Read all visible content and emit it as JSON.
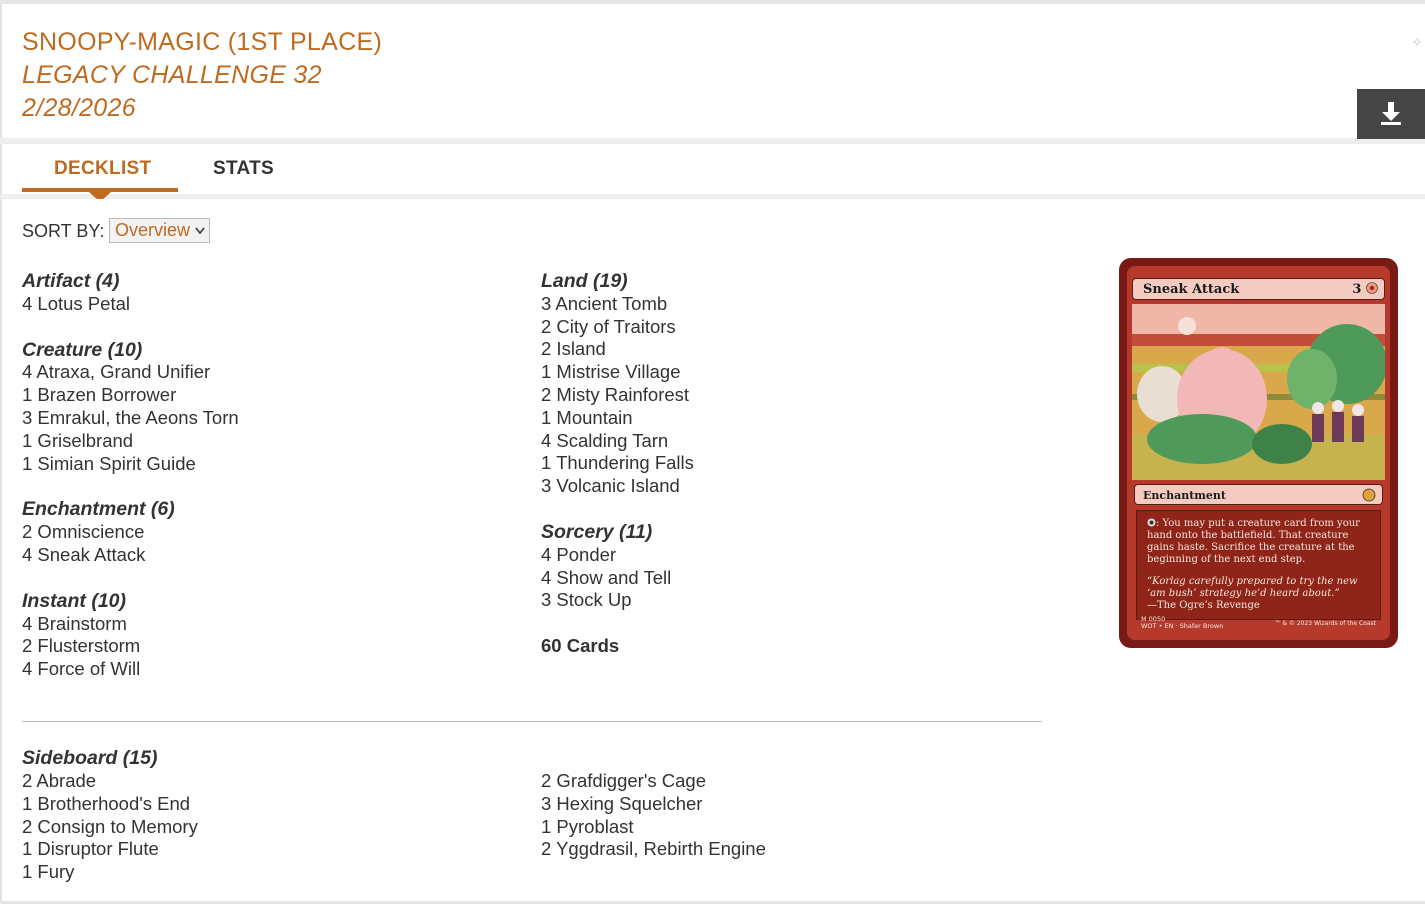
{
  "header": {
    "player_line": "SNOOPY-MAGIC (1ST PLACE)",
    "event_line": "LEGACY CHALLENGE 32",
    "date_line": "2/28/2026",
    "download_icon": "download-icon"
  },
  "tabs": [
    {
      "label": "DECKLIST",
      "active": true
    },
    {
      "label": "STATS",
      "active": false
    }
  ],
  "sort": {
    "label": "SORT BY:",
    "selected": "Overview"
  },
  "colors": {
    "accent": "#bf6a1e",
    "text": "#333333",
    "download_bg": "#454545"
  },
  "mainboard": {
    "left": [
      {
        "title": "Artifact (4)",
        "cards": [
          "4 Lotus Petal"
        ]
      },
      {
        "title": "Creature (10)",
        "cards": [
          "4 Atraxa, Grand Unifier",
          "1 Brazen Borrower",
          "3 Emrakul, the Aeons Torn",
          "1 Griselbrand",
          "1 Simian Spirit Guide"
        ]
      },
      {
        "title": "Enchantment (6)",
        "cards": [
          "2 Omniscience",
          "4 Sneak Attack"
        ]
      },
      {
        "title": "Instant (10)",
        "cards": [
          "4 Brainstorm",
          "2 Flusterstorm",
          "4 Force of Will"
        ]
      }
    ],
    "right": [
      {
        "title": "Land (19)",
        "cards": [
          "3 Ancient Tomb",
          "2 City of Traitors",
          "2 Island",
          "1 Mistrise Village",
          "2 Misty Rainforest",
          "1 Mountain",
          "4 Scalding Tarn",
          "1 Thundering Falls",
          "3 Volcanic Island"
        ]
      },
      {
        "title": "Sorcery (11)",
        "cards": [
          "4 Ponder",
          "4 Show and Tell",
          "3 Stock Up"
        ]
      }
    ],
    "total": "60 Cards"
  },
  "sideboard": {
    "title": "Sideboard (15)",
    "left": [
      "2 Abrade",
      "1 Brotherhood's End",
      "2 Consign to Memory",
      "1 Disruptor Flute",
      "1 Fury"
    ],
    "right": [
      "2 Grafdigger's Cage",
      "3 Hexing Squelcher",
      "1 Pyroblast",
      "2 Yggdrasil, Rebirth Engine"
    ]
  },
  "card_preview": {
    "name": "Sneak Attack",
    "cost": "3",
    "type_line": "Enchantment",
    "rules_text": ": You may put a creature card from your hand onto the battlefield. That creature gains haste. Sacrifice the creature at the beginning of the next end step.",
    "flavor_text": "“Korlag carefully prepared to try the new ‘am bush’ strategy he’d heard about.”",
    "flavor_attribution": "—The Ogre’s Revenge",
    "collector_line": "M 0050",
    "set_line": "WOT • EN",
    "artist": "Shafer Brown",
    "copyright": "™ & © 2023 Wizards of the Coast"
  }
}
